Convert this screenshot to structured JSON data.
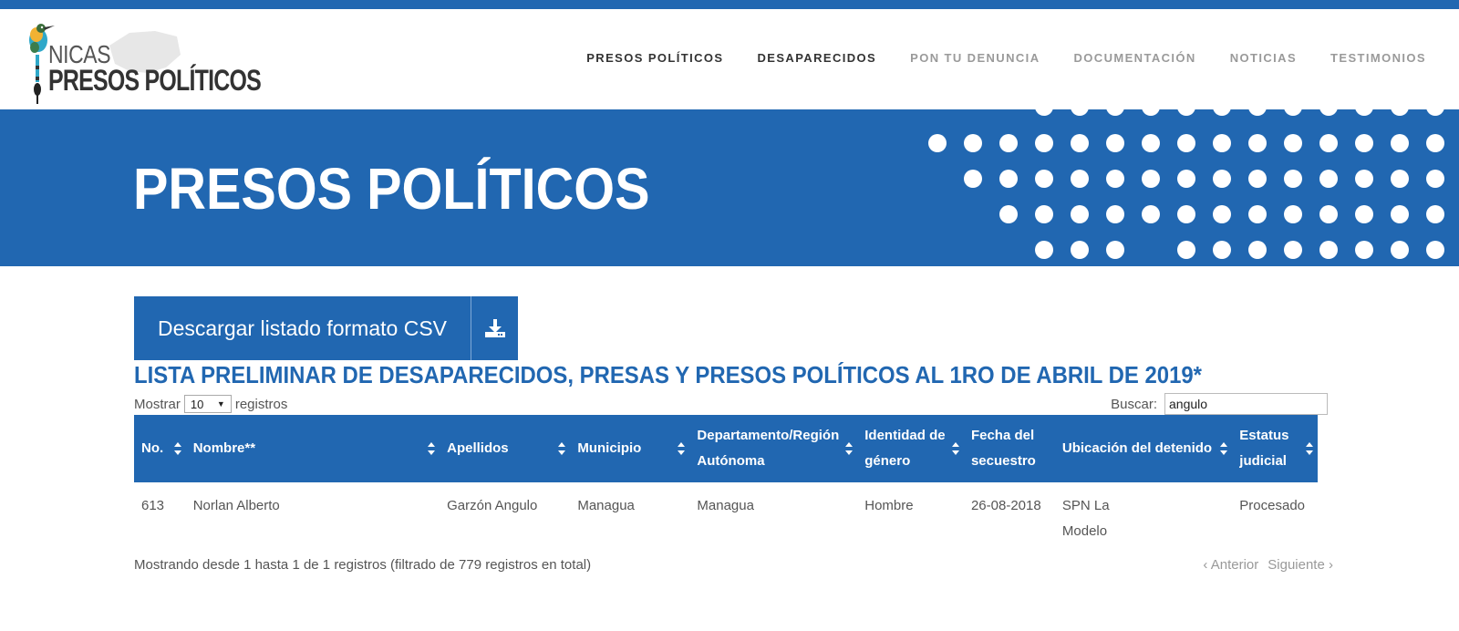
{
  "logo": {
    "line1": "NICAS",
    "line2": "PRESOS POLÍTICOS"
  },
  "nav": [
    {
      "label": "PRESOS POLÍTICOS",
      "active": true
    },
    {
      "label": "DESAPARECIDOS",
      "active": true
    },
    {
      "label": "PON TU DENUNCIA",
      "active": false
    },
    {
      "label": "DOCUMENTACIÓN",
      "active": false
    },
    {
      "label": "NOTICIAS",
      "active": false
    },
    {
      "label": "TESTIMONIOS",
      "active": false
    }
  ],
  "hero": {
    "title": "PRESOS POLÍTICOS"
  },
  "csv": {
    "label": "Descargar listado formato CSV",
    "icon": "download-icon"
  },
  "list": {
    "title": "LISTA PRELIMINAR DE DESAPARECIDOS, PRESAS Y PRESOS POLÍTICOS AL 1RO DE ABRIL DE 2019*"
  },
  "controls": {
    "show_label": "Mostrar",
    "show_value": "10",
    "records_label": "registros",
    "search_label": "Buscar:",
    "search_value": "angulo"
  },
  "table": {
    "headers": [
      "No.",
      "Nombre**",
      "Apellidos",
      "Municipio",
      "Departamento/Región Autónoma",
      "Identidad de género",
      "Fecha del secuestro",
      "Ubicación del detenido",
      "Estatus judicial"
    ],
    "rows": [
      [
        "613",
        "Norlan Alberto",
        "Garzón Angulo",
        "Managua",
        "Managua",
        "Hombre",
        "26-08-2018",
        "SPN La Modelo",
        "Procesado"
      ]
    ]
  },
  "footer": {
    "info": "Mostrando desde 1 hasta 1 de 1 registros (filtrado de 779 registros en total)",
    "prev": "Anterior",
    "next": "Siguiente"
  },
  "colors": {
    "brand_blue": "#2167b1"
  }
}
